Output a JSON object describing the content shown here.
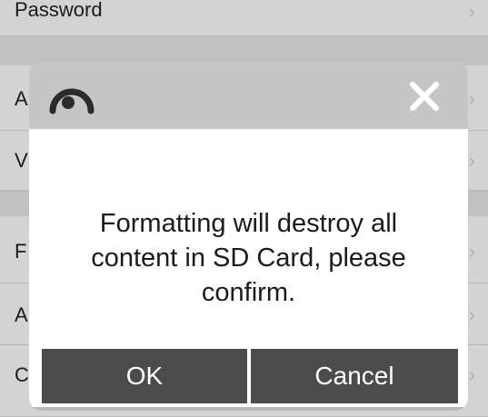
{
  "settings": {
    "rows": [
      {
        "label": "Password",
        "chevron": "›"
      },
      {
        "label": "A",
        "chevron": "›"
      },
      {
        "label": "V",
        "chevron": "›"
      },
      {
        "label": "F",
        "chevron": "›"
      },
      {
        "label": "A",
        "chevron": "›"
      },
      {
        "label": "C",
        "chevron": "›"
      }
    ]
  },
  "dialog": {
    "message": "Formatting will destroy all content in SD Card, please confirm.",
    "ok_label": "OK",
    "cancel_label": "Cancel",
    "header_icon": "eye-icon",
    "close_icon": "close-icon"
  },
  "colors": {
    "dialog_header": "#c6c6c6",
    "dialog_body": "#ffffff",
    "button_bg": "#4b4b4b",
    "button_text": "#ffffff"
  }
}
